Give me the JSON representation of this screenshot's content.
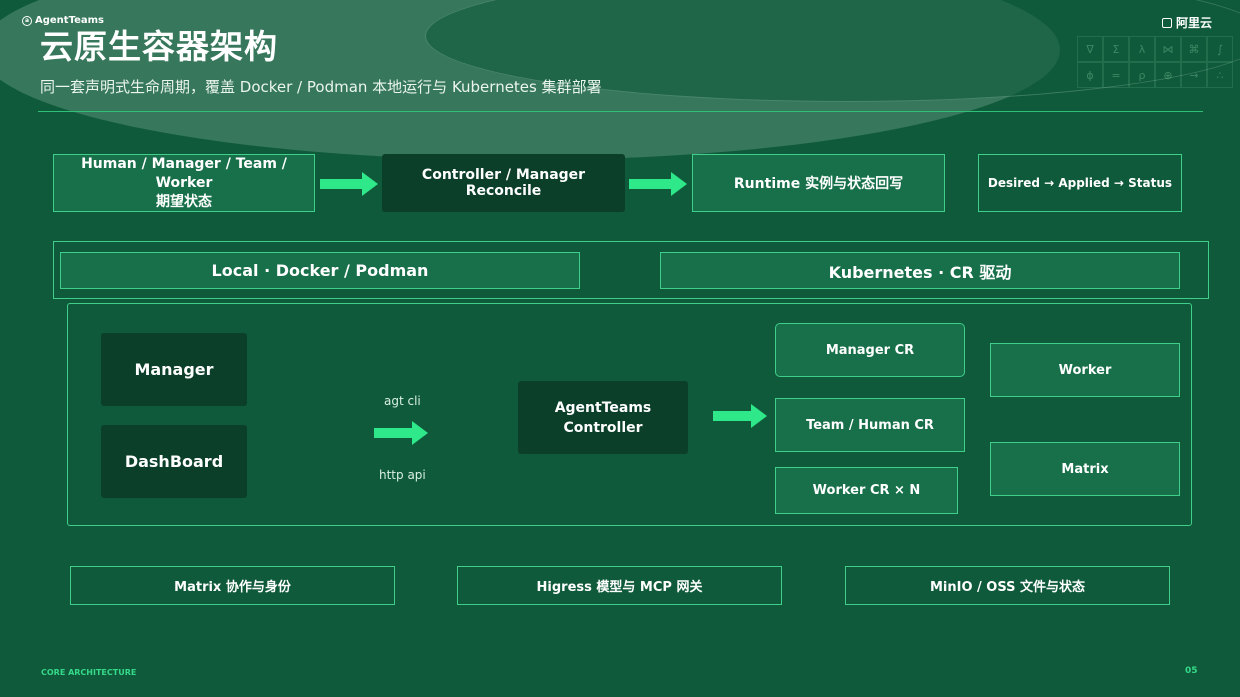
{
  "header": {
    "logo": "AgentTeams",
    "brand": "阿里云",
    "title": "云原生容器架构",
    "subtitle": "同一套声明式生命周期，覆盖 Docker / Podman 本地运行与 Kubernetes 集群部署"
  },
  "decor_grid": [
    "∇",
    "Σ",
    "λ",
    "⋈",
    "⌘",
    "∫",
    "ϕ",
    "=",
    "ρ",
    "⊕",
    "→",
    "∴"
  ],
  "flow": {
    "desired": "Human / Manager / Team / Worker\n期望状态",
    "controller": "Controller / Manager Reconcile",
    "runtime": "Runtime 实例与状态回写",
    "status_chain": "Desired → Applied → Status"
  },
  "modes": {
    "local": "Local · Docker / Podman",
    "k8s": "Kubernetes · CR 驱动"
  },
  "arch": {
    "manager": "Manager",
    "dashboard": "DashBoard",
    "agt_cli": "agt cli",
    "http_api": "http api",
    "controller": "AgentTeams\nController",
    "manager_cr": "Manager CR",
    "team_cr": "Team / Human CR",
    "worker_cr": "Worker CR × N",
    "worker": "Worker",
    "matrix": "Matrix"
  },
  "services": {
    "matrix": "Matrix 协作与身份",
    "higress": "Higress 模型与 MCP 网关",
    "minio": "MinIO / OSS 文件与状态"
  },
  "footer": {
    "section": "CORE ARCHITECTURE",
    "page": "05"
  },
  "colors": {
    "background": "#0f5a3a",
    "accent": "#2ee88a",
    "border": "#3fcf8a",
    "dark_block": "#0b3f29"
  }
}
